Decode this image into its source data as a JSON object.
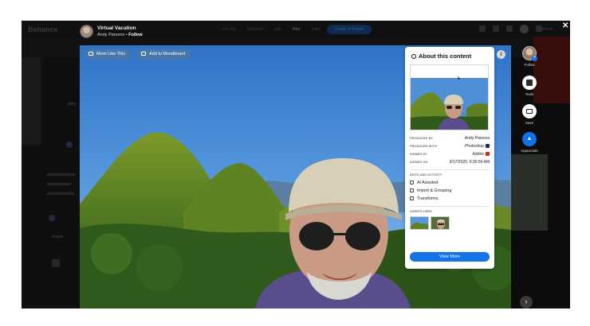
{
  "topbar": {
    "logo": "Behance",
    "nav": [
      "For You",
      "Discover",
      "Live",
      "Hire",
      "Jobs"
    ],
    "create_label": "Create a Project",
    "adobe_label": "Adobe"
  },
  "project": {
    "title": "Virtual Vacation",
    "author": "Andy Parsons",
    "follow_label": "Follow"
  },
  "toolbar": {
    "more_like_this": "More Like This",
    "add_to_moodboard": "Add to Moodboard"
  },
  "about": {
    "title": "About this content",
    "produced_by_key": "PRODUCED BY",
    "produced_by": "Andy Parsons",
    "produced_with_key": "PRODUCED WITH",
    "produced_with": "Photoshop",
    "signed_by_key": "SIGNED BY",
    "signed_by": "Adobe",
    "signed_on_key": "SIGNED ON",
    "signed_on": "9/17/2020, 9:30:56 AM",
    "edits_title": "EDITS AND ACTIVITY",
    "edits": [
      "AI Assisted",
      "Import & Grouping",
      "Transforms"
    ],
    "assets_title": "ASSETS USED",
    "view_more": "View More"
  },
  "actions": {
    "follow": "Follow",
    "tools": "Tools",
    "save": "Save",
    "appreciate": "Appreciate"
  },
  "colors": {
    "accent": "#1473e6",
    "panel": "#ffffff",
    "overlay": "#121212"
  }
}
